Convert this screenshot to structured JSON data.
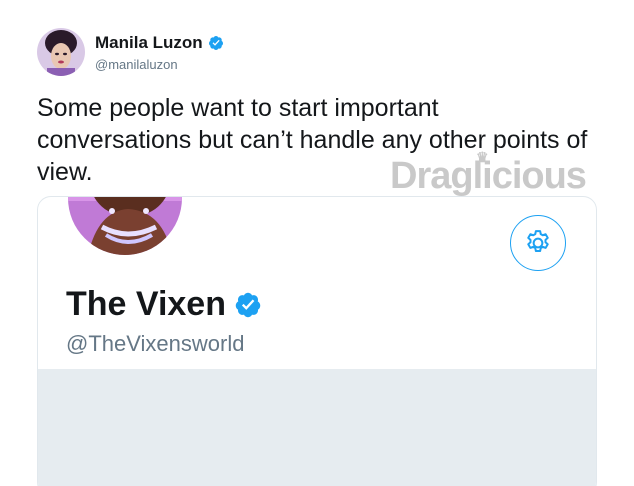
{
  "tweet": {
    "author": {
      "display_name": "Manila Luzon",
      "handle": "@manilaluzon",
      "verified": true
    },
    "text": "Some people want to start important conversations but can’t handle any other points of view."
  },
  "watermark": {
    "text": "Draglicious"
  },
  "profile_card": {
    "display_name": "The Vixen",
    "handle": "@TheVixensworld",
    "verified": true,
    "settings_icon": "gear-icon"
  },
  "colors": {
    "twitter_blue": "#1da1f2",
    "secondary_text": "#657786",
    "banner_gray": "#e6ecf0"
  }
}
